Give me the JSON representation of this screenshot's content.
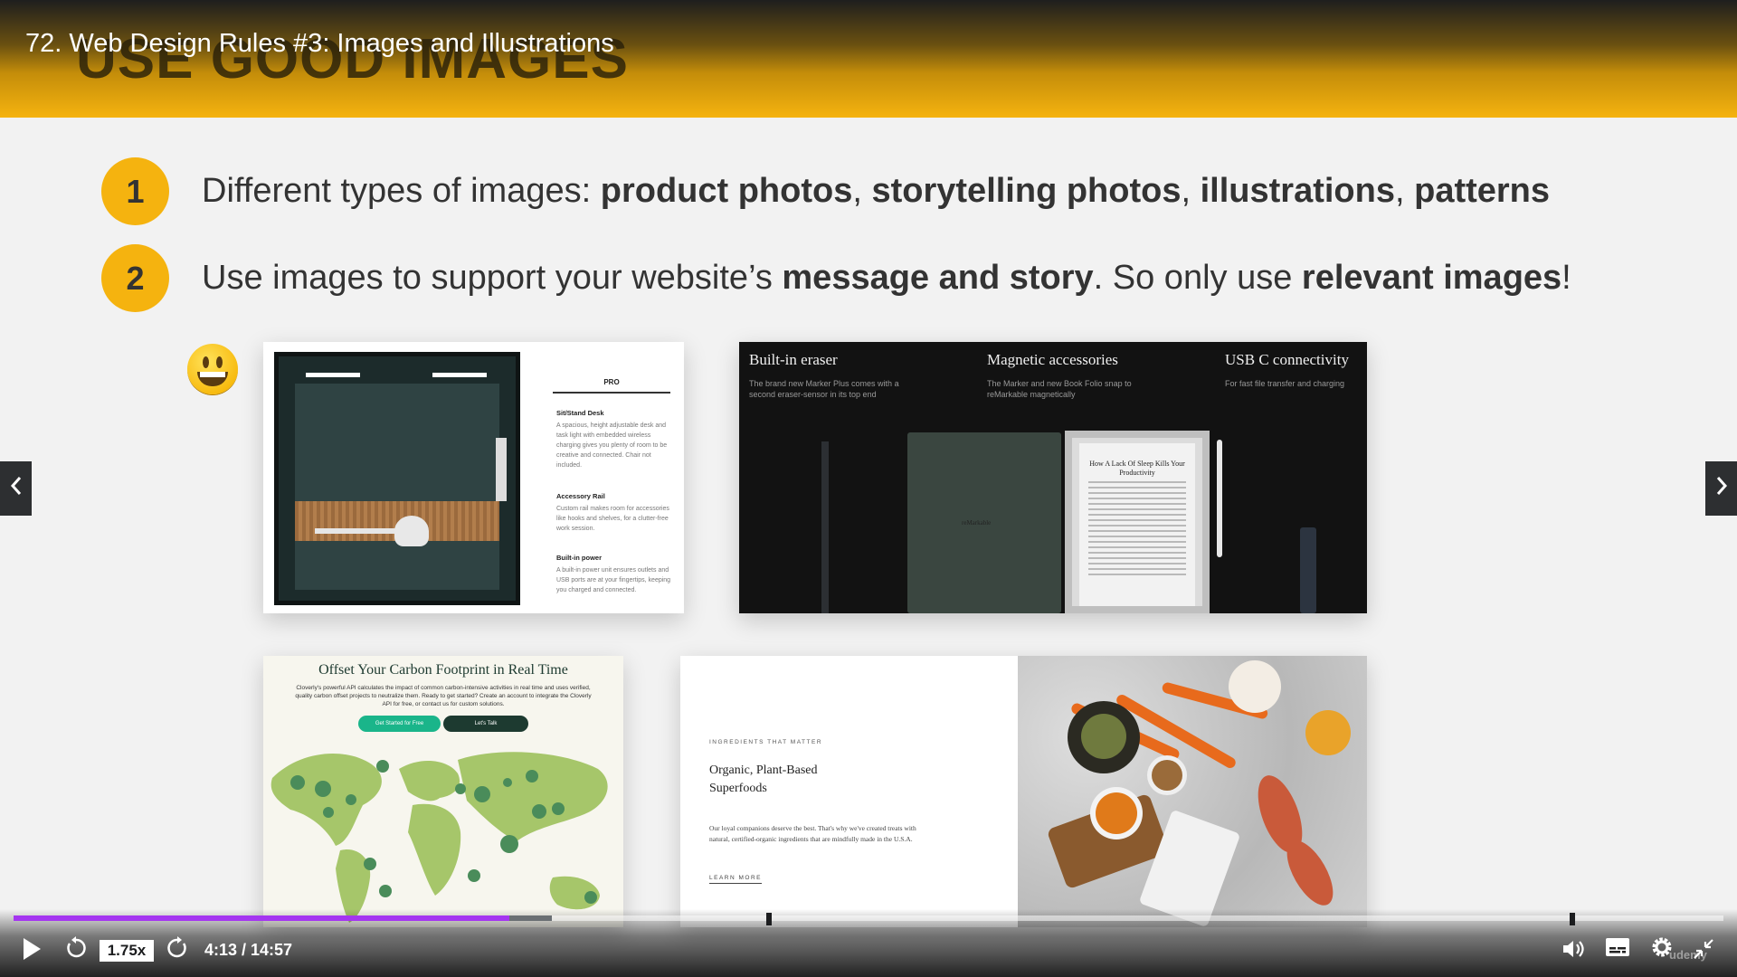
{
  "header": {
    "video_title": "72. Web Design Rules #3: Images and Illustrations",
    "slide_heading_ghost": "USE GOOD IMAGES"
  },
  "points": [
    {
      "number": "1",
      "text_a": "Different types of images: ",
      "bold_a": "product photos",
      "sep1": ", ",
      "bold_b": "storytelling photos",
      "sep2": ", ",
      "bold_c": "illustrations",
      "sep3": ", ",
      "bold_d": "patterns"
    },
    {
      "number": "2",
      "text_a": "Use images to support your website’s ",
      "bold_a": "message and story",
      "text_b": ". So only use ",
      "bold_b": "relevant images",
      "text_c": "!"
    }
  ],
  "examples": {
    "booth": {
      "pro_label": "PRO",
      "specs": [
        {
          "title": "Sit/Stand Desk",
          "body": "A spacious, height adjustable desk and task light with embedded wireless charging gives you plenty of room to be creative and connected. Chair not included."
        },
        {
          "title": "Accessory Rail",
          "body": "Custom rail makes room for accessories like hooks and shelves, for a clutter-free work session."
        },
        {
          "title": "Built-in power",
          "body": "A built-in power unit ensures outlets and USB ports are at your fingertips, keeping you charged and connected."
        }
      ]
    },
    "tablet": {
      "features": [
        {
          "title": "Built-in eraser",
          "body": "The brand new Marker Plus comes with a second eraser-sensor in its top end"
        },
        {
          "title": "Magnetic accessories",
          "body": "The Marker and new Book Folio snap to reMarkable magnetically"
        },
        {
          "title": "USB C connectivity",
          "body": "For fast file transfer and charging"
        }
      ],
      "folio_brand": "reMarkable",
      "page_title": "How A Lack Of Sleep Kills Your Productivity"
    },
    "carbon": {
      "title": "Offset Your Carbon Footprint in Real Time",
      "blurb": "Cloverly's powerful API calculates the impact of common carbon-intensive activities in real time and uses verified, quality carbon offset projects to neutralize them. Ready to get started? Create an account to integrate the Cloverly API for free, or contact us for custom solutions.",
      "cta_primary": "Get Started for Free",
      "cta_secondary": "Let's Talk"
    },
    "food": {
      "kicker": "INGREDIENTS THAT MATTER",
      "heading": "Organic, Plant-Based Superfoods",
      "body": "Our loyal companions deserve the best. That's why we've created treats with natural, certified-organic ingredients that are mindfully made in the U.S.A.",
      "link": "LEARN MORE"
    }
  },
  "player": {
    "speed": "1.75x",
    "time": "4:13 / 14:57",
    "progress_played_fraction": 0.29,
    "progress_buffered_fraction": 0.315,
    "chapter_marker_fractions": [
      0.44,
      0.91
    ],
    "watermark": "udemy"
  },
  "colors": {
    "accent_yellow": "#f5b30f",
    "progress_purple": "#a435f0",
    "cta_green": "#1ab58a",
    "cta_dark": "#1d3a30"
  },
  "icons": {
    "prev": "chevron-left-icon",
    "next": "chevron-right-icon",
    "play": "play-icon",
    "rewind": "rewind-5-icon",
    "forward": "forward-5-icon",
    "volume": "volume-icon",
    "captions": "captions-icon",
    "settings": "gear-icon",
    "exit_fullscreen": "exit-fullscreen-icon"
  }
}
